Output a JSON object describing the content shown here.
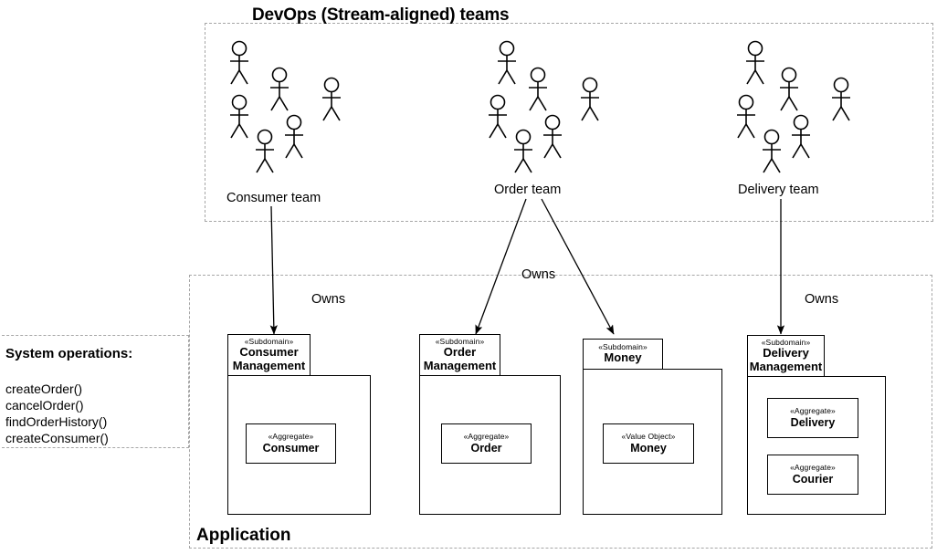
{
  "diagram": {
    "teams_container": {
      "title": "DevOps (Stream-aligned) teams",
      "teams": [
        {
          "label": "Consumer team",
          "figure_count": 6
        },
        {
          "label": "Order team",
          "figure_count": 6
        },
        {
          "label": "Delivery team",
          "figure_count": 6
        }
      ]
    },
    "application_container": {
      "title": "Application",
      "packages": [
        {
          "stereotype": "«Subdomain»",
          "name_line1": "Consumer",
          "name_line2": "Management",
          "children": [
            {
              "stereotype": "«Aggregate»",
              "name": "Consumer"
            }
          ]
        },
        {
          "stereotype": "«Subdomain»",
          "name_line1": "Order",
          "name_line2": "Management",
          "children": [
            {
              "stereotype": "«Aggregate»",
              "name": "Order"
            }
          ]
        },
        {
          "stereotype": "«Subdomain»",
          "name_line1": "Money",
          "name_line2": "",
          "children": [
            {
              "stereotype": "«Value Object»",
              "name": "Money"
            }
          ]
        },
        {
          "stereotype": "«Subdomain»",
          "name_line1": "Delivery",
          "name_line2": "Management",
          "children": [
            {
              "stereotype": "«Aggregate»",
              "name": "Delivery"
            },
            {
              "stereotype": "«Aggregate»",
              "name": "Courier"
            }
          ]
        }
      ]
    },
    "system_operations": {
      "title": "System operations:",
      "operations": [
        "createOrder()",
        "cancelOrder()",
        "findOrderHistory()",
        "createConsumer()"
      ]
    },
    "relationship_labels": [
      {
        "text": "Owns"
      },
      {
        "text": "Owns"
      },
      {
        "text": "Owns"
      }
    ],
    "colors": {
      "stroke": "#000000",
      "dashed_border": "#a6a6a6",
      "background": "#ffffff"
    }
  }
}
